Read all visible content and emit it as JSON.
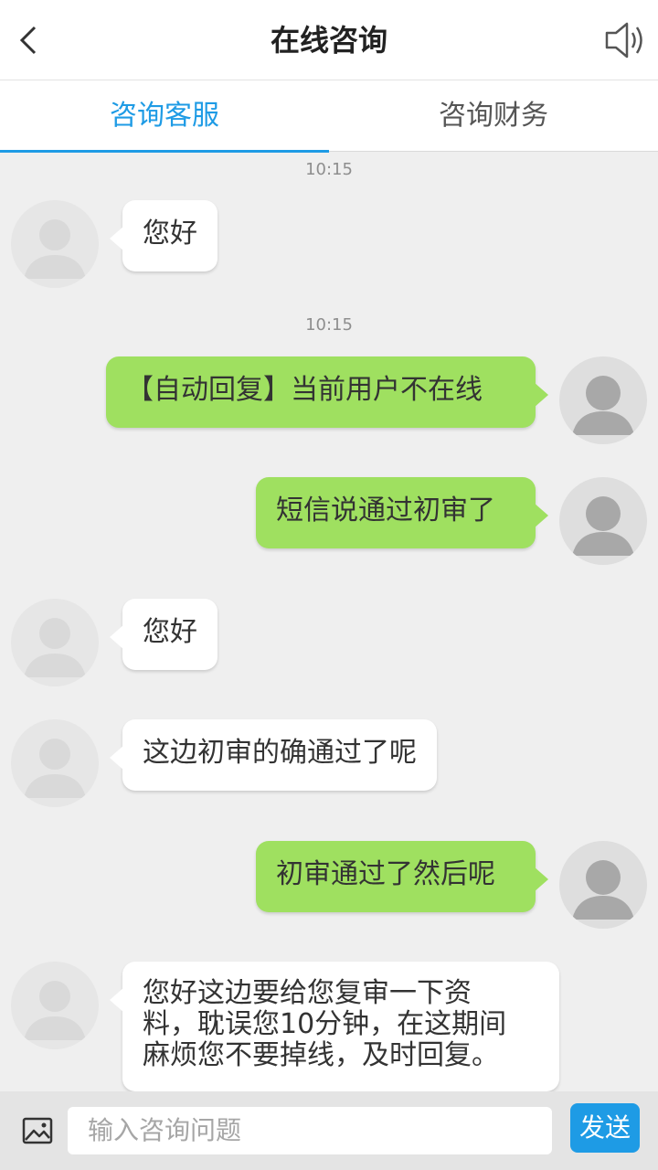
{
  "header": {
    "title": "在线咨询",
    "back_icon": "chevron-left-icon",
    "speaker_icon": "speaker-icon"
  },
  "tabs": [
    {
      "label": "咨询客服",
      "active": true
    },
    {
      "label": "咨询财务",
      "active": false
    }
  ],
  "messages": {
    "time1": "10:15",
    "m1": "您好",
    "time2": "10:15",
    "m2": "【自动回复】当前用户不在线",
    "m3": "短信说通过初审了",
    "m4": "您好",
    "m5": "这边初审的确通过了呢",
    "m6": "初审通过了然后呢",
    "m7_line1": "您好这边要给您复审一下资",
    "m7_line2": "料，耽误您10分钟，在这期间",
    "m7_line3": "麻烦您不要掉线，及时回复。"
  },
  "input": {
    "placeholder": "输入咨询问题",
    "send_label": "发送",
    "image_icon": "image-icon"
  },
  "colors": {
    "accent": "#1e9be5",
    "self_bubble": "#9fe060",
    "other_bubble": "#ffffff",
    "background": "#efefef"
  }
}
